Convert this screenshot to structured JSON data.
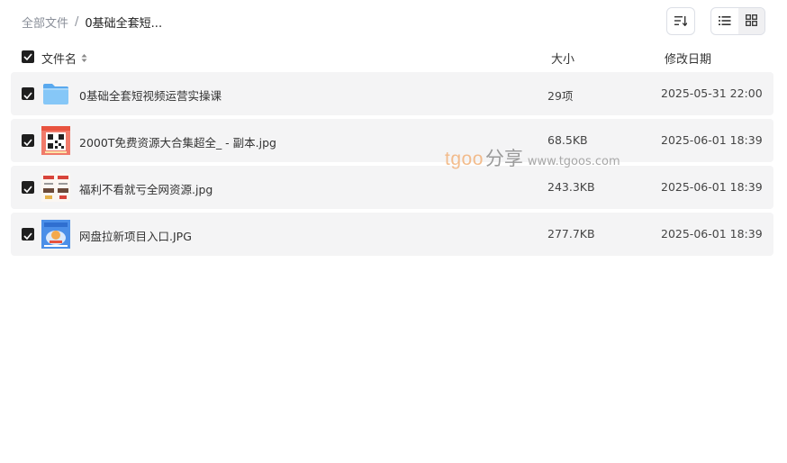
{
  "breadcrumb": {
    "root": "全部文件",
    "separator": "/",
    "current": "0基础全套短..."
  },
  "toolbar": {
    "sort_icon": "sort-lines-icon",
    "list_view_icon": "list-icon",
    "grid_view_icon": "grid-icon",
    "active_view": "grid"
  },
  "columns": {
    "name": "文件名",
    "size": "大小",
    "date": "修改日期"
  },
  "files": [
    {
      "name": "0基础全套短视频运营实操课",
      "size": "29项",
      "date": "2025-05-31 22:00",
      "type": "folder",
      "checked": true
    },
    {
      "name": "2000T免费资源大合集超全_ - 副本.jpg",
      "size": "68.5KB",
      "date": "2025-06-01 18:39",
      "type": "image",
      "checked": true
    },
    {
      "name": "福利不看就亏全网资源.jpg",
      "size": "243.3KB",
      "date": "2025-06-01 18:39",
      "type": "image",
      "checked": true
    },
    {
      "name": "网盘拉新项目入口.JPG",
      "size": "277.7KB",
      "date": "2025-06-01 18:39",
      "type": "image",
      "checked": true
    }
  ],
  "watermark": {
    "brand": "tgoo",
    "cn": "分享",
    "url": "www.tgoos.com"
  },
  "colors": {
    "row_bg": "#f4f4f5",
    "checkbox": "#1f1f1f",
    "folder": "#7cc0f5",
    "watermark_brand": "#f2b27a"
  }
}
